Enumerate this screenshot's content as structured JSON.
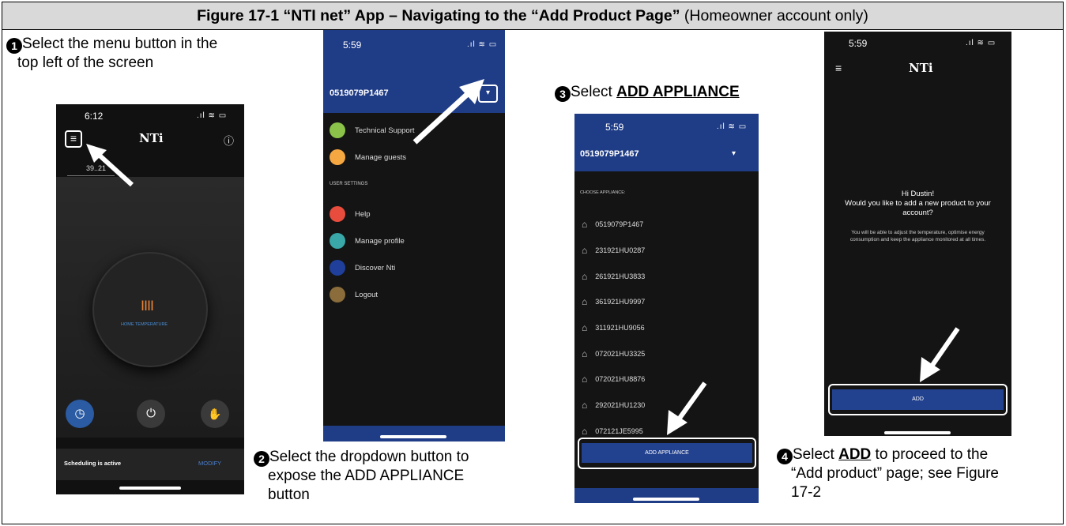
{
  "header": {
    "title_bold": "Figure 17-1 “NTI net” App – Navigating to the “Add Product Page”",
    "title_normal": " (Homeowner account only)"
  },
  "steps": [
    {
      "num": "1",
      "line1": "Select the menu button in the",
      "line2": "top left of the screen"
    },
    {
      "num": "2",
      "line1": "Select the dropdown button to",
      "line2": "expose the ADD APPLIANCE",
      "line3": "button"
    },
    {
      "num": "3",
      "prefix": "Select ",
      "emph": "ADD APPLIANCE"
    },
    {
      "num": "4",
      "prefix": "Select ",
      "emph": "ADD",
      "suffix": " to proceed to the",
      "line2": "“Add product” page; see Figure",
      "line3": "17-2"
    }
  ],
  "screen1": {
    "time": "6:12",
    "logo": "NTi",
    "tab": "39..21",
    "dial_label": "HOME TEMPERATURE",
    "status": "Scheduling is active",
    "modify": "MODIFY"
  },
  "screen2": {
    "time": "5:59",
    "device_id": "0519079P1467",
    "menu_top": [
      {
        "label": "Technical Support",
        "icon": "support-icon",
        "color": "#8bc34a"
      },
      {
        "label": "Manage guests",
        "icon": "guests-icon",
        "color": "#f5a742"
      }
    ],
    "section": "USER SETTINGS",
    "menu_bottom": [
      {
        "label": "Help",
        "icon": "help-icon",
        "color": "#e74c3c"
      },
      {
        "label": "Manage profile",
        "icon": "profile-icon",
        "color": "#3aa8a8"
      },
      {
        "label": "Discover Nti",
        "icon": "nti-icon",
        "color": "#1f3f9a"
      },
      {
        "label": "Logout",
        "icon": "logout-icon",
        "color": "#8a6d3b"
      }
    ]
  },
  "screen3": {
    "time": "5:59",
    "device_id": "0519079P1467",
    "choose": "CHOOSE APPLIANCE:",
    "appliances": [
      "0519079P1467",
      "231921HU0287",
      "261921HU3833",
      "361921HU9997",
      "311921HU9056",
      "072021HU3325",
      "072021HU8876",
      "292021HU1230",
      "072121JE5995"
    ],
    "button": "ADD APPLIANCE"
  },
  "screen4": {
    "time": "5:59",
    "logo": "NTi",
    "greeting": "Hi Dustin!",
    "question": "Would you like to add a new product to your account?",
    "body": "You will be able to adjust the temperature, optimise energy consumption and keep the appliance monitored at all times.",
    "button": "ADD"
  },
  "colors": {
    "nti_blue": "#1f3c86",
    "accent_blue": "#2f5aa8",
    "title_bg": "#d9d9d9"
  }
}
